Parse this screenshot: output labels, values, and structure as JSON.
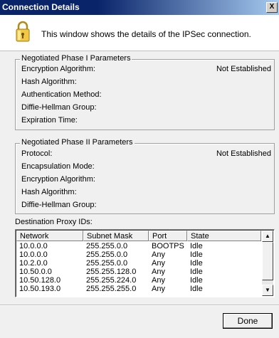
{
  "window": {
    "title": "Connection Details",
    "close_label": "X"
  },
  "header": {
    "text": "This window shows the details of the IPSec connection.",
    "icon": "lock-icon"
  },
  "phase1": {
    "title": "Negotiated Phase I Parameters",
    "rows": [
      {
        "label": "Encryption Algorithm:",
        "value": "Not Established"
      },
      {
        "label": "Hash Algorithm:",
        "value": ""
      },
      {
        "label": "Authentication Method:",
        "value": ""
      },
      {
        "label": "Diffie-Hellman Group:",
        "value": ""
      },
      {
        "label": "Expiration Time:",
        "value": ""
      }
    ]
  },
  "phase2": {
    "title": "Negotiated Phase II Parameters",
    "rows": [
      {
        "label": "Protocol:",
        "value": "Not Established"
      },
      {
        "label": "Encapsulation Mode:",
        "value": ""
      },
      {
        "label": "Encryption Algorithm:",
        "value": ""
      },
      {
        "label": "Hash Algorithm:",
        "value": ""
      },
      {
        "label": "Diffie-Hellman Group:",
        "value": ""
      }
    ]
  },
  "proxy": {
    "label": "Destination Proxy IDs:",
    "columns": [
      "Network",
      "Subnet Mask",
      "Port",
      "State"
    ],
    "rows": [
      [
        "10.0.0.0",
        "255.255.0.0",
        "BOOTPS",
        "Idle"
      ],
      [
        "10.0.0.0",
        "255.255.0.0",
        "Any",
        "Idle"
      ],
      [
        "10.2.0.0",
        "255.255.0.0",
        "Any",
        "Idle"
      ],
      [
        "10.50.0.0",
        "255.255.128.0",
        "Any",
        "Idle"
      ],
      [
        "10.50.128.0",
        "255.255.224.0",
        "Any",
        "Idle"
      ],
      [
        "10.50.193.0",
        "255.255.255.0",
        "Any",
        "Idle"
      ]
    ]
  },
  "buttons": {
    "done": "Done"
  }
}
